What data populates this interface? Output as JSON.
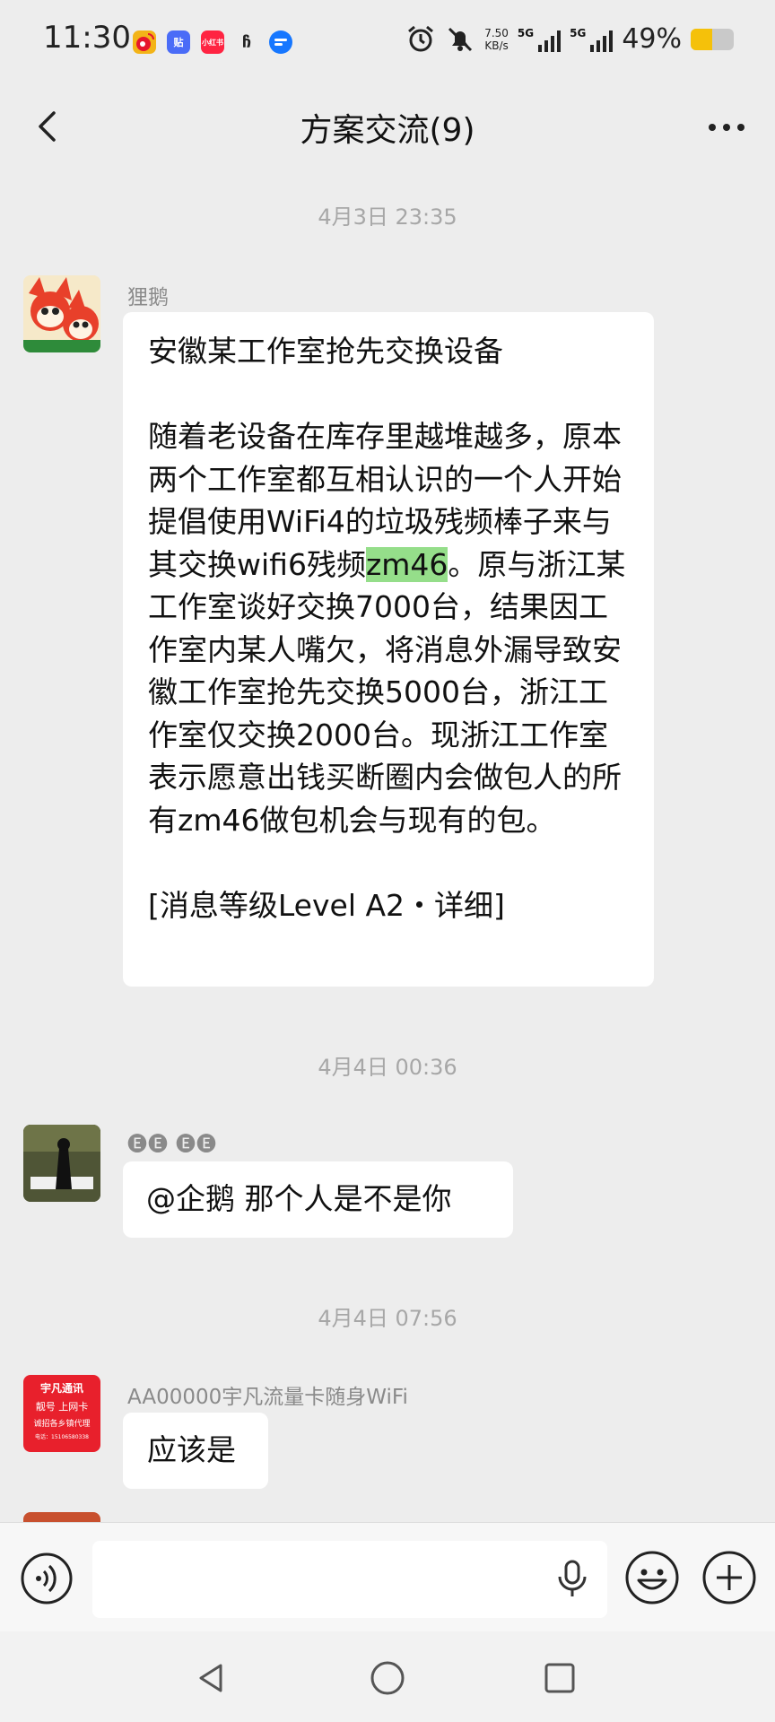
{
  "status_bar": {
    "time": "11:30",
    "net_speed": "7.50",
    "net_unit": "KB/s",
    "signal1": "5G",
    "signal2": "5G",
    "battery_text": "49%",
    "battery_level": 0.49,
    "app_icons": [
      "weibo-icon",
      "tieba-icon",
      "xiaohongshu-icon",
      "app-icon",
      "app-icon"
    ]
  },
  "header": {
    "title": "方案交流(9)"
  },
  "messages": [
    {
      "time": "4月3日 23:35",
      "sender": "狸鹅",
      "text_before": "安徽某工作室抢先交换设备\n\n随着老设备在库存里越堆越多，原本两个工作室都互相认识的一个人开始提倡使用WiFi4的垃圾残频棒子来与其交换wifi6残频",
      "highlight": "zm46",
      "text_after": "。原与浙江某工作室谈好交换7000台，结果因工作室内某人嘴欠，将消息外漏导致安徽工作室抢先交换5000台，浙江工作室仅交换2000台。现浙江工作室表示愿意出钱买断圈内会做包人的所有zm46做包机会与现有的包。\n\n[消息等级Level A2・详细]"
    },
    {
      "time": "4月4日 00:36",
      "sender": "🅔🅔 🅔🅔",
      "text": "@企鹅  那个人是不是你"
    },
    {
      "time": "4月4日 07:56",
      "sender": "AA00000宇凡流量卡随身WiFi",
      "text": "应该是",
      "avatar_text": [
        "宇凡通讯",
        "靓号 上网卡",
        "诚招各乡镇代理",
        "电话：15106580338"
      ]
    }
  ],
  "colors": {
    "background": "#ededed",
    "bubble": "#ffffff",
    "highlight": "#95de8a",
    "battery": "#f5c10a"
  }
}
